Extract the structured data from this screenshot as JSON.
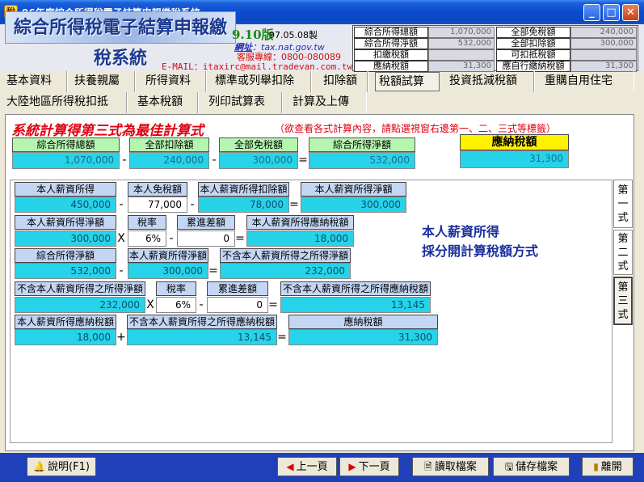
{
  "window": {
    "title": "96年度綜合所得稅電子結算申報繳稅系統",
    "icon_glyph": "稅"
  },
  "banner": {
    "logo_title": "綜合所得稅電子結算申報繳稅系統",
    "version": "9.10版",
    "version_date": "97.05.08製",
    "website_label": "網址",
    "website": "：tax.nat.gov.tw",
    "service": "客服專線：0800-080089",
    "email": "E-MAIL：itaxirc@mail.tradevan.com.tw"
  },
  "summary": {
    "left": [
      {
        "label": "綜合所得總額",
        "value": "1,070,000"
      },
      {
        "label": "綜合所得淨額",
        "value": "532,000"
      },
      {
        "label": "扣繳稅額",
        "value": ""
      },
      {
        "label": "應納稅額",
        "value": "31,300"
      }
    ],
    "right": [
      {
        "label": "全部免稅額",
        "value": "240,000"
      },
      {
        "label": "全部扣除額",
        "value": "300,000"
      },
      {
        "label": "可扣抵稅額",
        "value": ""
      },
      {
        "label": "應自行繳納稅額",
        "value": "31,300"
      }
    ]
  },
  "tabs_row1": [
    "基本資料",
    "扶養親屬",
    "所得資料",
    "標準或列舉扣除",
    "扣除額",
    "稅額試算",
    "投資抵減稅額",
    "重購自用住宅"
  ],
  "tabs_row2": [
    "大陸地區所得稅扣抵",
    "基本稅額",
    "列印試算表",
    "計算及上傳"
  ],
  "active_tab": "稅額試算",
  "main": {
    "headline": "系統計算得第三式為最佳計算式",
    "hint": "（欲查看各式計算內容，請點選視窗右邊第一、二、三式等標籤）",
    "top_labels": [
      "綜合所得總額",
      "全部扣除額",
      "全部免稅額",
      "綜合所得淨額"
    ],
    "top_values": [
      "1,070,000",
      "240,000",
      "300,000",
      "532,000"
    ],
    "tax_label": "應納稅額",
    "tax_value": "31,300",
    "ops": [
      "-",
      "-",
      "=",
      "X",
      "-",
      "=",
      "-",
      "=",
      "X",
      "-",
      "=",
      "+",
      "="
    ],
    "row1": {
      "labels": [
        "本人薪資所得",
        "本人免稅額",
        "本人薪資所得扣除額",
        "本人薪資所得淨額"
      ],
      "values": [
        "450,000",
        "77,000",
        "78,000",
        "300,000"
      ]
    },
    "row2": {
      "labels": [
        "本人薪資所得淨額",
        "稅率",
        "累進差額",
        "本人薪資所得應納稅額"
      ],
      "values": [
        "300,000",
        "6%",
        "0",
        "18,000"
      ]
    },
    "row3": {
      "labels": [
        "綜合所得淨額",
        "本人薪資所得淨額",
        "不含本人薪資所得之所得淨額"
      ],
      "values": [
        "532,000",
        "300,000",
        "232,000"
      ]
    },
    "row4": {
      "labels": [
        "不含本人薪資所得之所得淨額",
        "稅率",
        "累進差額",
        "不含本人薪資所得之所得應納稅額"
      ],
      "values": [
        "232,000",
        "6%",
        "0",
        "13,145"
      ]
    },
    "row5": {
      "labels": [
        "本人薪資所得應納稅額",
        "不含本人薪資所得之所得應納稅額",
        "應納稅額"
      ],
      "values": [
        "18,000",
        "13,145",
        "31,300"
      ]
    },
    "side_note_line1": "本人薪資所得",
    "side_note_line2": "採分開計算稅額方式",
    "vtabs": [
      "第一式",
      "第二式",
      "第三式"
    ],
    "active_vtab": "第三式"
  },
  "bottom": {
    "help": "說明(F1)",
    "prev": "上一頁",
    "next": "下一頁",
    "load": "讀取檔案",
    "save": "儲存檔案",
    "exit": "離開"
  }
}
